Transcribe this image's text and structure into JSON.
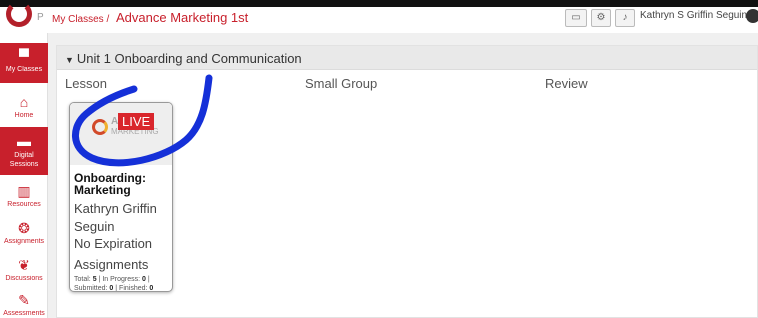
{
  "header": {
    "breadcrumb_root": "My Classes /",
    "course_title": "Advance Marketing 1st",
    "user_name": "Kathryn S Griffin Seguin"
  },
  "sidebar": {
    "items": [
      {
        "label": "My Classes",
        "icon": "whiteboard-icon"
      },
      {
        "label": "Home",
        "icon": "home-icon"
      },
      {
        "label": "Digital Sessions",
        "icon": "laptop-icon"
      },
      {
        "label": "Resources",
        "icon": "books-icon"
      },
      {
        "label": "Assignments",
        "icon": "brain-icon"
      },
      {
        "label": "Discussions",
        "icon": "chat-bubbles-icon"
      },
      {
        "label": "Assessments",
        "icon": "clipboard-icon"
      }
    ]
  },
  "unit": {
    "title": "Unit 1 Onboarding and Communication",
    "columns": [
      "Lesson",
      "Small Group",
      "Review"
    ]
  },
  "card": {
    "badge": "LIVE",
    "thumb_brand_1": "ASS",
    "thumb_brand_2": "MARKETING",
    "title": "Onboarding: Marketing",
    "author": "Kathryn Griffin Seguin",
    "expiration": "No Expiration",
    "assignments_label": "Assignments",
    "stats": {
      "total_label": "Total:",
      "total": "5",
      "in_progress_label": "In Progress:",
      "in_progress": "0",
      "submitted_label": "Submitted:",
      "submitted": "0",
      "finished_label": "Finished:",
      "finished": "0"
    }
  },
  "colors": {
    "brand_red": "#c8202c",
    "annotation_blue": "#1530d8"
  }
}
